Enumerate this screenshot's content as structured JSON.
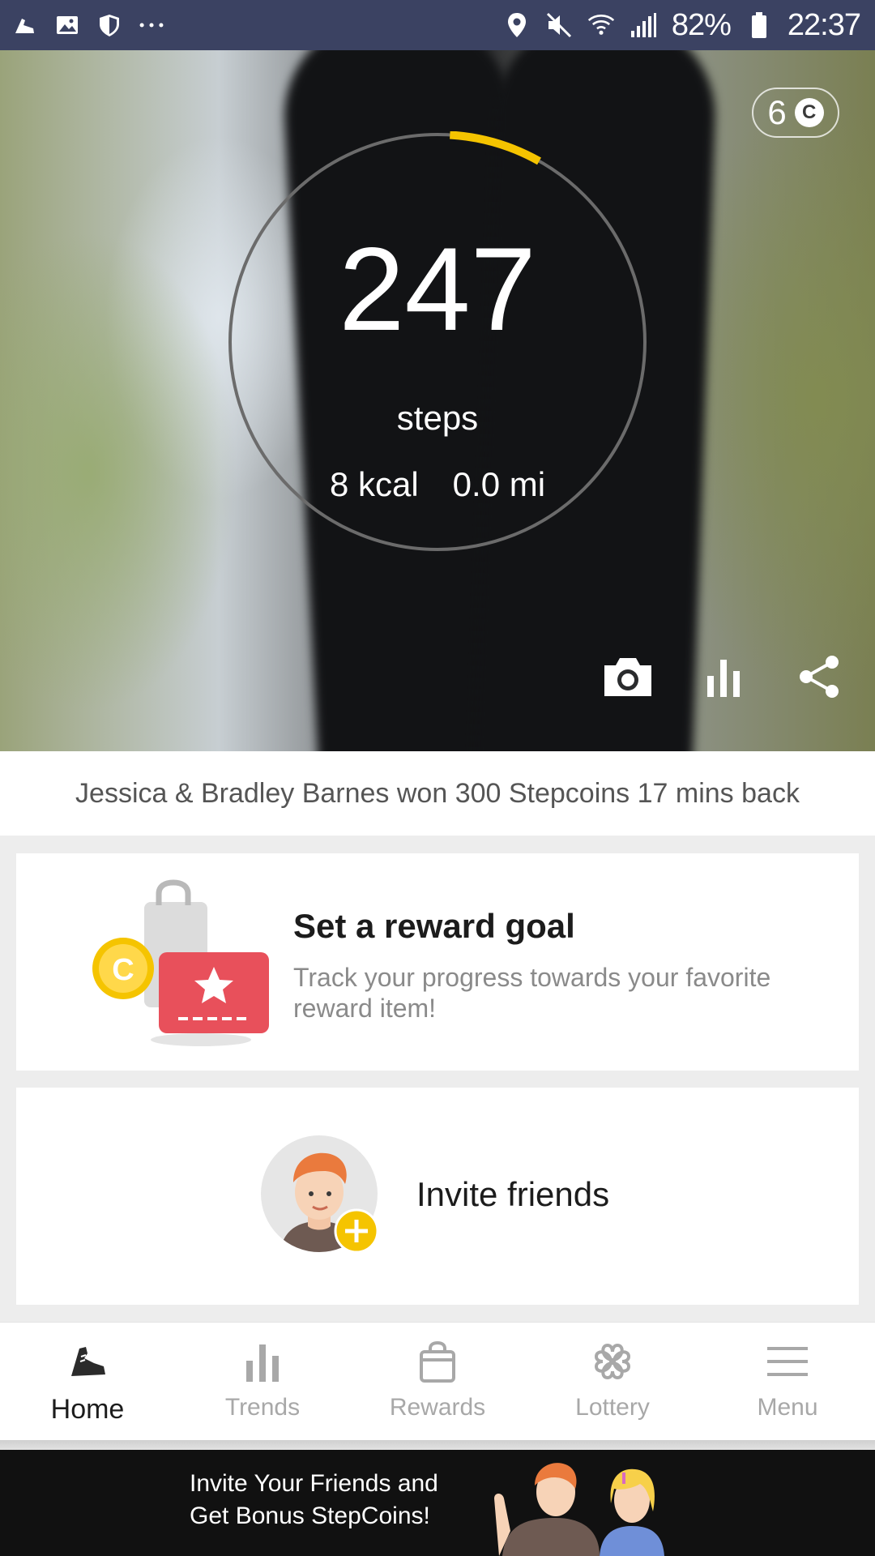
{
  "status_bar": {
    "battery": "82%",
    "time": "22:37",
    "left_icons": [
      "shoe-notification-icon",
      "image-icon",
      "shield-icon",
      "more-dots-icon"
    ],
    "right_icons": [
      "location-icon",
      "mute-icon",
      "wifi-icon",
      "signal-icon",
      "battery-icon"
    ]
  },
  "hero": {
    "coins": "6",
    "coin_symbol": "C",
    "steps": "247",
    "steps_label": "steps",
    "kcal": "8 kcal",
    "distance": "0.0 mi",
    "goal_progress_fraction": 0.012,
    "ring_color": "#6b6b6b",
    "progress_color": "#f5c400",
    "actions": [
      "camera-icon",
      "chart-icon",
      "share-icon"
    ]
  },
  "ticker": {
    "text": "Jessica & Bradley Barnes won 300 Stepcoins 17 mins back"
  },
  "reward_card": {
    "title": "Set a reward goal",
    "description": "Track your progress towards your favorite reward item!",
    "coin_symbol": "C"
  },
  "invite_card": {
    "label": "Invite friends"
  },
  "nav": {
    "items": [
      {
        "label": "Home",
        "icon": "shoe-icon",
        "active": true
      },
      {
        "label": "Trends",
        "icon": "bar-chart-icon",
        "active": false
      },
      {
        "label": "Rewards",
        "icon": "shopping-bag-icon",
        "active": false
      },
      {
        "label": "Lottery",
        "icon": "clover-icon",
        "active": false
      },
      {
        "label": "Menu",
        "icon": "hamburger-icon",
        "active": false
      }
    ]
  },
  "banner": {
    "line1": "Invite Your Friends and",
    "line2": "Get Bonus StepCoins!"
  },
  "colors": {
    "status_bar": "#3b4262",
    "accent_yellow": "#f5c400",
    "reward_red": "#e8505b",
    "banner_bg": "#111111"
  }
}
